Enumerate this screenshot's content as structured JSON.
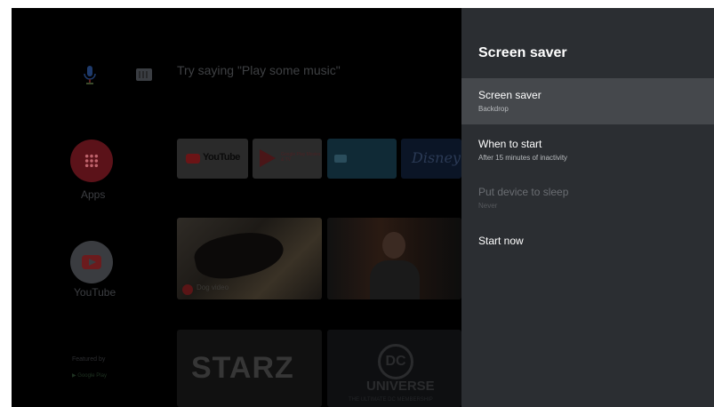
{
  "home": {
    "search_hint": "Try saying \"Play some music\"",
    "apps_label": "Apps",
    "youtube_label": "YouTube",
    "tiles": {
      "youtube_text": "YouTube",
      "play_text": "Google Play Movies & TV",
      "disney_text": "Disney+",
      "dog_caption": "Dog video",
      "starz_text": "STARZ",
      "dc_logo": "DC",
      "dc_universe": "UNIVERSE",
      "dc_sub": "THE ULTIMATE DC MEMBERSHIP"
    },
    "featured_by": "Featured by",
    "google_play": "▶ Google Play"
  },
  "panel": {
    "title": "Screen saver",
    "items": [
      {
        "label": "Screen saver",
        "sub": "Backdrop"
      },
      {
        "label": "When to start",
        "sub": "After 15 minutes of inactivity"
      },
      {
        "label": "Put device to sleep",
        "sub": "Never"
      },
      {
        "label": "Start now",
        "sub": ""
      }
    ]
  },
  "colors": {
    "panel_bg": "#2b2e32",
    "selected_bg": "#45484c",
    "screen_bg": "#000000"
  }
}
